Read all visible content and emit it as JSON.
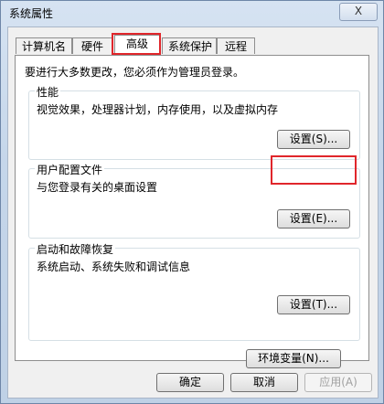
{
  "window": {
    "title": "系统属性",
    "close_label": "X"
  },
  "tabs": [
    {
      "label": "计算机名"
    },
    {
      "label": "硬件"
    },
    {
      "label": "高级",
      "active": true
    },
    {
      "label": "系统保护"
    },
    {
      "label": "远程"
    }
  ],
  "admin_note": "要进行大多数更改，您必须作为管理员登录。",
  "performance": {
    "title": "性能",
    "description": "视觉效果，处理器计划，内存使用，以及虚拟内存",
    "button": "设置(S)..."
  },
  "user_profiles": {
    "title": "用户配置文件",
    "description": "与您登录有关的桌面设置",
    "button": "设置(E)..."
  },
  "startup_recovery": {
    "title": "启动和故障恢复",
    "description": "系统启动、系统失败和调试信息",
    "button": "设置(T)..."
  },
  "env_button": "环境变量(N)...",
  "footer": {
    "ok": "确定",
    "cancel": "取消",
    "apply": "应用(A)"
  },
  "colors": {
    "highlight": "#e0262b"
  }
}
